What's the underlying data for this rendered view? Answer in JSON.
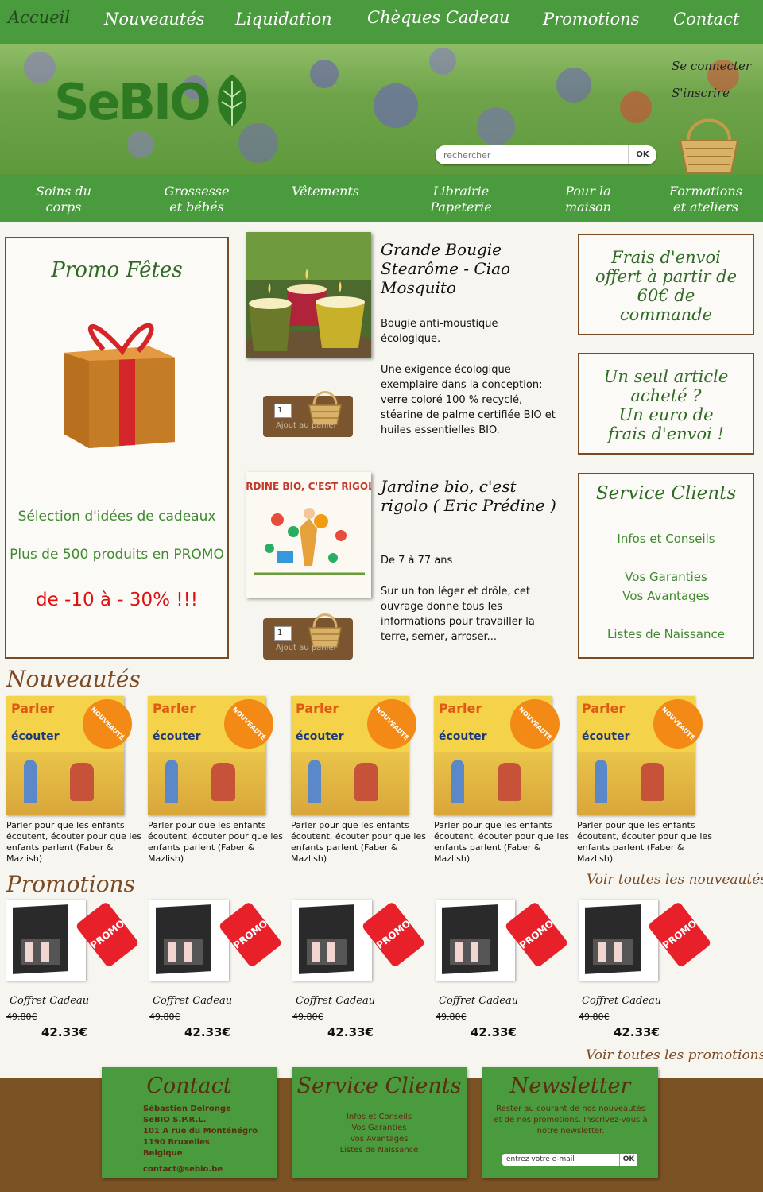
{
  "top_nav": {
    "items": [
      "Accueil",
      "Nouveautés",
      "Liquidation",
      "Chèques Cadeau",
      "Promotions",
      "Contact"
    ]
  },
  "header": {
    "logo": "SeBIO",
    "login": "Se connecter",
    "signup": "S'inscrire",
    "search_placeholder": "rechercher",
    "search_button": "OK"
  },
  "categories": [
    [
      "Soins du",
      "corps"
    ],
    [
      "Grossesse",
      "et bébés"
    ],
    [
      "Vêtements",
      ""
    ],
    [
      "Librairie",
      "Papeterie"
    ],
    [
      "Pour la",
      "maison"
    ],
    [
      "Formations",
      "et ateliers"
    ]
  ],
  "promo_box": {
    "title": "Promo Fêtes",
    "line1": "Sélection d'idées de cadeaux",
    "line2": "Plus de 500 produits en PROMO",
    "discount": "de -10 à - 30% !!!"
  },
  "featured": [
    {
      "title_lines": [
        "Grande Bougie",
        "Stearôme - Ciao",
        "Mosquito"
      ],
      "desc1": "Bougie anti-moustique écologique.",
      "desc2": "Une exigence écologique exemplaire dans la conception: verre coloré 100 % recyclé, stéarine de palme certifiée BIO et huiles essentielles BIO.",
      "qty": "1",
      "add_label": "Ajout au panier"
    },
    {
      "title_lines": [
        "Jardine bio, c'est",
        "rigolo ( Eric Prédine )"
      ],
      "desc1": "De 7 à 77 ans",
      "desc2": "Sur un ton léger et drôle, cet ouvrage donne tous les informations pour travailler la terre, semer, arroser...",
      "qty": "1",
      "add_label": "Ajout au panier",
      "cover_title": "JARDINE BIO, C'EST RIGOLO"
    }
  ],
  "right_boxes": {
    "shipping": [
      "Frais d'envoi",
      "offert à partir de",
      "60€ de",
      "commande"
    ],
    "one_euro": [
      "Un seul article",
      "acheté ?",
      "Un euro de",
      "frais d'envoi !"
    ],
    "service": {
      "title": "Service Clients",
      "links": [
        "Infos et Conseils",
        "Vos Garanties",
        "Vos Avantages",
        "Listes de Naissance"
      ]
    }
  },
  "nouveautes": {
    "title": "Nouveautés",
    "see_all": "Voir toutes les nouveautés",
    "badge": "NOUVEAUTÉ",
    "cover_title": "Parler",
    "cover_sub": "écouter",
    "items": [
      "Parler pour que les enfants écoutent, écouter pour que les enfants parlent (Faber & Mazlish)",
      "Parler pour que les enfants écoutent, écouter pour que les enfants parlent (Faber & Mazlish)",
      "Parler pour que les enfants écoutent, écouter pour que les enfants parlent (Faber & Mazlish)",
      "Parler pour que les enfants écoutent, écouter pour que les enfants parlent (Faber & Mazlish)",
      "Parler pour que les enfants écoutent, écouter pour que les enfants parlent (Faber & Mazlish)"
    ]
  },
  "promotions": {
    "title": "Promotions",
    "see_all": "Voir toutes les promotions",
    "tag": "PROMO",
    "items": [
      {
        "name": "Coffret Cadeau",
        "old_price": "49.80€",
        "price": "42.33€"
      },
      {
        "name": "Coffret Cadeau",
        "old_price": "49.80€",
        "price": "42.33€"
      },
      {
        "name": "Coffret Cadeau",
        "old_price": "49.80€",
        "price": "42.33€"
      },
      {
        "name": "Coffret Cadeau",
        "old_price": "49.80€",
        "price": "42.33€"
      },
      {
        "name": "Coffret Cadeau",
        "old_price": "49.80€",
        "price": "42.33€"
      }
    ]
  },
  "footer": {
    "contact": {
      "title": "Contact",
      "lines": [
        "Sébastien Delronge",
        "SeBIO S.P.R.L.",
        "101 A rue du Monténégro",
        "1190 Bruxelles",
        "Belgique"
      ],
      "email": "contact@sebio.be"
    },
    "service": {
      "title": "Service Clients",
      "links": [
        "Infos et Conseils",
        "Vos Garanties",
        "Vos Avantages",
        "Listes de Naissance"
      ]
    },
    "newsletter": {
      "title": "Newsletter",
      "text": "Rester au courant de nos nouveautés et de nos promotions. Inscrivez-vous à notre newsletter.",
      "placeholder": "entrez votre e-mail",
      "button": "OK"
    }
  },
  "colors": {
    "green": "#4a9a3e",
    "brown": "#7a4a24",
    "promo_red": "#e01010"
  }
}
